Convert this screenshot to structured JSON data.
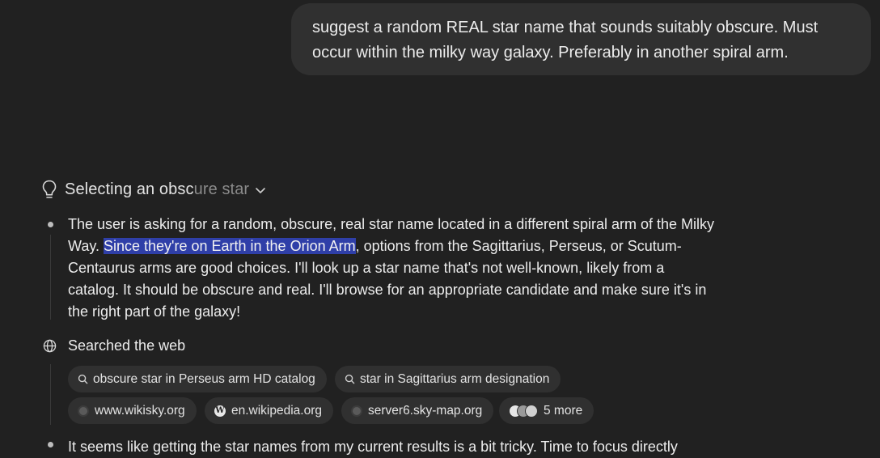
{
  "user_message": "suggest a random REAL star name that sounds suitably obscure. Must occur within the milky way galaxy. Preferably in another spiral arm.",
  "thought": {
    "title_main": "Selecting an obsc",
    "title_fade": "ure star",
    "para_1a": "The user is asking for a random, obscure, real star name located in a different spiral arm of the Milky Way. ",
    "para_1_highlight": "Since they're on Earth in the Orion Arm",
    "para_1b": ", options from the Sagittarius, Perseus, or Scutum-Centaurus arms are good choices. I'll look up a star name that's not well-known, likely from a catalog. It should be obscure and real. I'll browse for an appropriate candidate and make sure it's in the right part of the galaxy!",
    "searched_label": "Searched the web",
    "queries": [
      "obscure star in Perseus arm HD catalog",
      "star in Sagittarius arm designation"
    ],
    "sources": [
      {
        "label": "www.wikisky.org",
        "icon": "gray-globe-favicon"
      },
      {
        "label": "en.wikipedia.org",
        "icon": "wikipedia-favicon"
      },
      {
        "label": "server6.sky-map.org",
        "icon": "gray-globe-favicon"
      }
    ],
    "more_label": "5 more",
    "para_2_partial": "It seems like getting the star names from my current results is a bit tricky. Time to focus directly"
  }
}
